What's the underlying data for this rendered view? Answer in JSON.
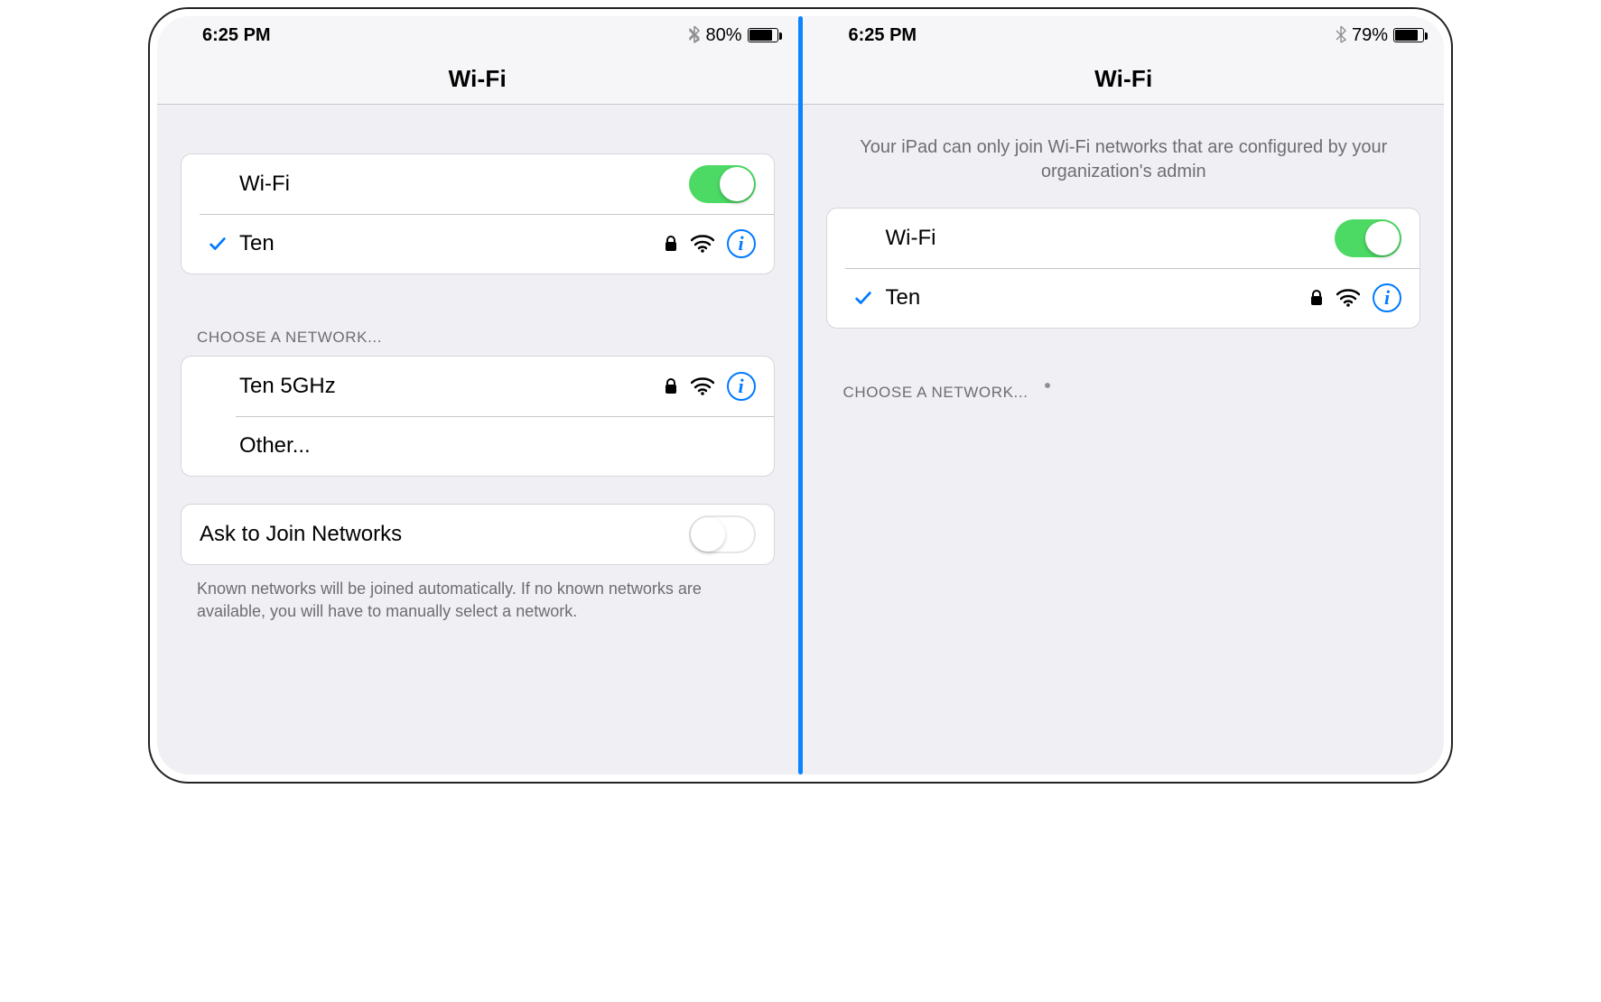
{
  "left": {
    "status": {
      "time": "6:25 PM",
      "battery_pct": "80%",
      "battery_fill": 80
    },
    "title": "Wi-Fi",
    "wifi_row_label": "Wi-Fi",
    "connected": {
      "name": "Ten"
    },
    "choose_header": "CHOOSE A NETWORK...",
    "networks": [
      {
        "name": "Ten 5GHz",
        "locked": true
      },
      {
        "name": "Other..."
      }
    ],
    "ask_join_label": "Ask to Join Networks",
    "ask_join_footer": "Known networks will be joined automatically. If no known networks are available, you will have to manually select a network."
  },
  "right": {
    "status": {
      "time": "6:25 PM",
      "battery_pct": "79%",
      "battery_fill": 79
    },
    "title": "Wi-Fi",
    "restriction_text": "Your iPad can only join Wi-Fi networks that are configured by your organization's admin",
    "wifi_row_label": "Wi-Fi",
    "connected": {
      "name": "Ten"
    },
    "choose_header": "CHOOSE A NETWORK..."
  }
}
